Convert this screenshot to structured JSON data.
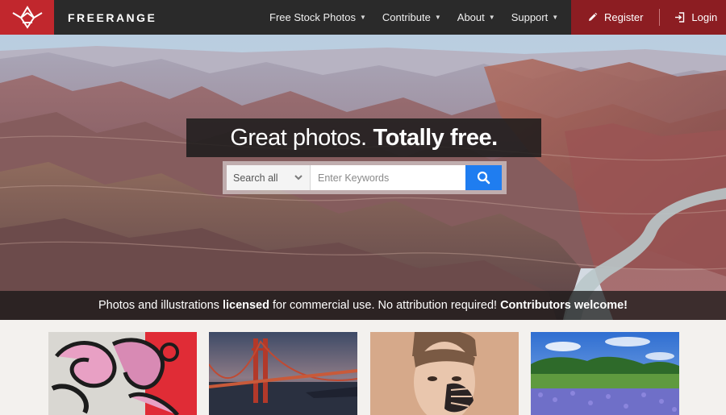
{
  "brand": {
    "name": "FREERANGE",
    "logo_icon": "freerange-diamond-logo-icon",
    "accent": "#c1272d"
  },
  "nav": {
    "items": [
      {
        "label": "Free Stock Photos"
      },
      {
        "label": "Contribute"
      },
      {
        "label": "About"
      },
      {
        "label": "Support"
      }
    ],
    "register_label": "Register",
    "login_label": "Login",
    "register_icon": "pencil-icon",
    "login_icon": "login-icon"
  },
  "hero": {
    "headline_light": "Great photos.",
    "headline_bold": "Totally free.",
    "search": {
      "category_selected": "Search all",
      "keywords_placeholder": "Enter Keywords",
      "keywords_value": "",
      "button_icon": "search-icon",
      "button_color": "#1f7df0"
    },
    "tagline": {
      "part1": "Photos and illustrations ",
      "bold1": "licensed",
      "part2": " for commercial use. No attribution required! ",
      "bold2": "Contributors welcome!"
    }
  },
  "gallery": {
    "thumbnails": [
      {
        "subject": "pink graffiti wall"
      },
      {
        "subject": "golden gate bridge at dusk"
      },
      {
        "subject": "boy with painted hand on face"
      },
      {
        "subject": "bluebonnet field under blue sky"
      }
    ]
  }
}
